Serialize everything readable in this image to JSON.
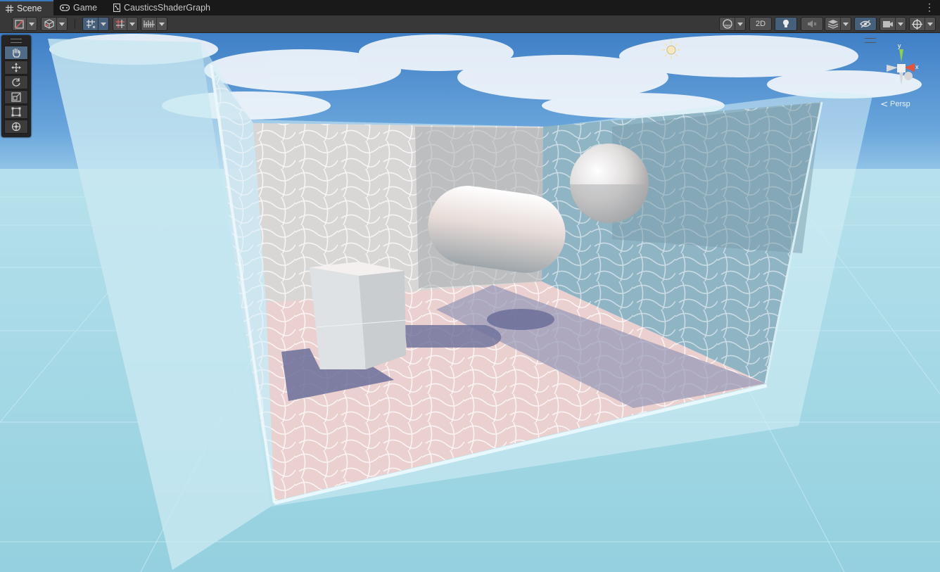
{
  "tabs": [
    {
      "label": "Scene",
      "icon": "grid-icon",
      "active": true
    },
    {
      "label": "Game",
      "icon": "gamepad-icon",
      "active": false
    },
    {
      "label": "CausticsShaderGraph",
      "icon": "shader-graph-icon",
      "active": false
    }
  ],
  "tab_menu_icon": "kebab-menu-icon",
  "toolbar": {
    "left": [
      {
        "name": "draw-mode",
        "icon": "shaded-draw-mode-icon",
        "dropdown": true
      },
      {
        "name": "render-mode",
        "icon": "render-cube-icon",
        "dropdown": true
      },
      {
        "name": "grid-snapping",
        "icon": "grid-snapping-icon",
        "dropdown": true,
        "active": true
      },
      {
        "name": "increment-snap",
        "icon": "increment-snap-icon",
        "dropdown": true
      },
      {
        "name": "snap-settings",
        "icon": "snap-ruler-icon",
        "dropdown": true
      }
    ],
    "right": [
      {
        "name": "shading",
        "icon": "shading-sphere-icon",
        "dropdown": true
      },
      {
        "name": "2d-toggle",
        "label": "2D"
      },
      {
        "name": "lighting-toggle",
        "icon": "light-bulb-icon",
        "active": true
      },
      {
        "name": "audio-toggle",
        "icon": "audio-mute-icon"
      },
      {
        "name": "effects",
        "icon": "effects-layers-icon",
        "dropdown": true
      },
      {
        "name": "scene-visibility",
        "icon": "eye-hidden-icon",
        "active": true
      },
      {
        "name": "camera-settings",
        "icon": "camera-icon",
        "dropdown": true
      },
      {
        "name": "gizmos",
        "icon": "gizmo-globe-icon",
        "dropdown": true
      }
    ]
  },
  "tools": [
    {
      "name": "hand-tool",
      "icon": "hand-icon",
      "active": true
    },
    {
      "name": "move-tool",
      "icon": "move-arrows-icon"
    },
    {
      "name": "rotate-tool",
      "icon": "rotate-icon"
    },
    {
      "name": "scale-tool",
      "icon": "scale-icon"
    },
    {
      "name": "rect-tool",
      "icon": "rect-transform-icon"
    },
    {
      "name": "transform-tool",
      "icon": "transform-icon"
    }
  ],
  "gizmo": {
    "axis_y": "y",
    "axis_x": "x",
    "projection": "Persp"
  },
  "scene": {
    "sky_color": "#4e8ccf",
    "ground_color": "#9dd4e2",
    "objects": [
      "glass-tank",
      "cube",
      "capsule",
      "sphere",
      "caustics-floor"
    ],
    "sun_icon": "sun-icon"
  }
}
